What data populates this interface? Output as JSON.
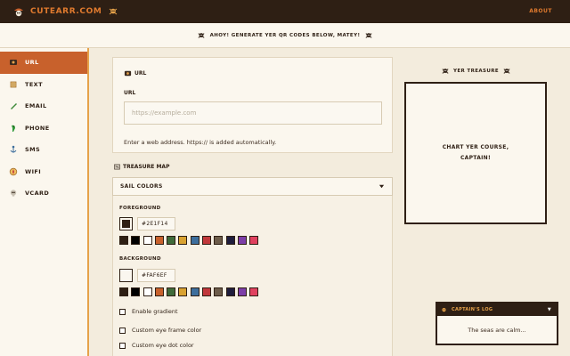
{
  "header": {
    "brand": "CUTEARR.COM",
    "about_label": "ABOUT"
  },
  "banner": {
    "text": "AHOY! GENERATE YER QR CODES BELOW, MATEY!"
  },
  "sidebar": {
    "items": [
      {
        "label": "URL",
        "icon": "link-icon",
        "active": true
      },
      {
        "label": "TEXT",
        "icon": "scroll-icon",
        "active": false
      },
      {
        "label": "EMAIL",
        "icon": "bottle-icon",
        "active": false
      },
      {
        "label": "PHONE",
        "icon": "parrot-icon",
        "active": false
      },
      {
        "label": "SMS",
        "icon": "anchor-icon",
        "active": false
      },
      {
        "label": "WIFI",
        "icon": "compass-icon",
        "active": false
      },
      {
        "label": "VCARD",
        "icon": "skull-icon",
        "active": false
      }
    ]
  },
  "url_card": {
    "title": "URL",
    "field_label": "URL",
    "placeholder": "https://example.com",
    "value": "",
    "help": "Enter a web address. https:// is added automatically."
  },
  "treasure_map": {
    "title": "TREASURE MAP",
    "select_label": "SAIL COLORS",
    "foreground_label": "FOREGROUND",
    "foreground_hex": "#2E1F14",
    "background_label": "BACKGROUND",
    "background_hex": "#FAF6EF",
    "swatch_colors": [
      "#2e1f14",
      "#000000",
      "#ffffff",
      "#c8612c",
      "#3f6b3a",
      "#d9a231",
      "#3d6e9c",
      "#c1383b",
      "#6d5c4a",
      "#1f1d3c",
      "#7d3fa8",
      "#e0415f"
    ],
    "options": [
      {
        "label": "Enable gradient",
        "checked": false
      },
      {
        "label": "Custom eye frame color",
        "checked": false
      },
      {
        "label": "Custom eye dot color",
        "checked": false
      }
    ]
  },
  "preview": {
    "title": "YER TREASURE",
    "placeholder": "CHART YER COURSE,\nCAPTAIN!"
  },
  "log": {
    "title": "CAPTAIN'S LOG",
    "message": "The seas are calm..."
  },
  "colors": {
    "dark": "#2e1f14",
    "accent": "#c8612c",
    "orange": "#e07a2e",
    "paper": "#f3ecdd"
  }
}
